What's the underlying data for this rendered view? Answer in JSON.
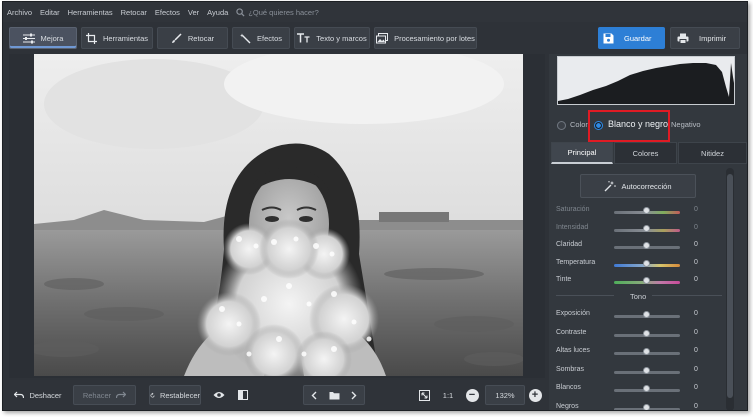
{
  "menu": {
    "items": [
      "Archivo",
      "Editar",
      "Herramientas",
      "Retocar",
      "Efectos",
      "Ver",
      "Ayuda"
    ],
    "search_placeholder": "¿Qué quieres hacer?"
  },
  "toolbar": {
    "tabs": [
      {
        "label": "Mejora",
        "icon": "sliders-icon"
      },
      {
        "label": "Herramientas",
        "icon": "crop-icon"
      },
      {
        "label": "Retocar",
        "icon": "brush-icon"
      },
      {
        "label": "Efectos",
        "icon": "magic-wand-icon"
      },
      {
        "label": "Texto y marcos",
        "icon": "text-icon"
      },
      {
        "label": "Procesamiento por lotes",
        "icon": "batch-images-icon"
      }
    ],
    "save_label": "Guardar",
    "print_label": "Imprimir"
  },
  "bottom": {
    "undo_label": "Deshacer",
    "redo_label": "Rehacer",
    "reset_label": "Restablecer",
    "ratio_label": "1:1",
    "zoom_value": "132%"
  },
  "panel": {
    "modes": [
      "Color",
      "Blanco y negro",
      "Negativo"
    ],
    "selected_mode": "Blanco y negro",
    "subtabs": [
      "Principal",
      "Colores",
      "Nitidez"
    ],
    "active_subtab": "Principal",
    "auto_label": "Autocorrección",
    "sliders_top": [
      {
        "label": "Saturación",
        "value": "0",
        "enabled": false,
        "position": 0.5
      },
      {
        "label": "Intensidad",
        "value": "0",
        "enabled": false,
        "position": 0.5
      },
      {
        "label": "Claridad",
        "value": "0",
        "enabled": true,
        "position": 0.5
      },
      {
        "label": "Temperatura",
        "value": "0",
        "enabled": true,
        "position": 0.5
      },
      {
        "label": "Tinte",
        "value": "0",
        "enabled": true,
        "position": 0.5
      }
    ],
    "tone_title": "Tono",
    "sliders_tone": [
      {
        "label": "Exposición",
        "value": "0",
        "position": 0.5
      },
      {
        "label": "Contraste",
        "value": "0",
        "position": 0.5
      },
      {
        "label": "Altas luces",
        "value": "0",
        "position": 0.5
      },
      {
        "label": "Sombras",
        "value": "0",
        "position": 0.5
      },
      {
        "label": "Blancos",
        "value": "0",
        "position": 0.5
      },
      {
        "label": "Negros",
        "value": "0",
        "position": 0.5
      }
    ]
  },
  "colors": {
    "accent": "#2d7fd6",
    "highlight": "#e01b24"
  }
}
